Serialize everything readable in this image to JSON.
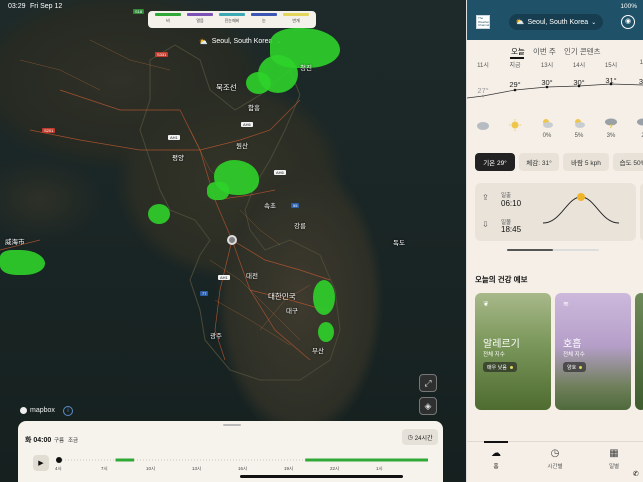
{
  "status": {
    "time": "03:29",
    "date": "Fri Sep 12",
    "battery": "100%"
  },
  "map": {
    "location": "Seoul, South Korea",
    "legend": [
      {
        "label": "비",
        "color": "#2fa836"
      },
      {
        "label": "얼음",
        "color": "#7b52b5"
      },
      {
        "label": "진눈깨비",
        "color": "#3da9b5"
      },
      {
        "label": "눈",
        "color": "#3d55b3"
      },
      {
        "label": "번개",
        "color": "#e3d65a"
      }
    ],
    "labels": {
      "north_korea": "북조선",
      "south_korea": "대한민국",
      "weihai": "威海市",
      "dokdo": "독도",
      "p1": "평양",
      "p2": "원산",
      "p3": "함흥",
      "p4": "청진",
      "p5": "속초",
      "p6": "대전",
      "p7": "광주",
      "p8": "부산",
      "p9": "대구",
      "p10": "강릉"
    },
    "shields": [
      "S18",
      "S331",
      "S201",
      "AH1",
      "AH6",
      "AH6",
      "55",
      "77",
      "AH1"
    ],
    "attribution": "mapbox"
  },
  "timeline": {
    "day_time": "화 04:00",
    "legend_1": "구름",
    "legend_2": "조금",
    "range_button": "24시간",
    "ticks": [
      "4시",
      "7시",
      "10시",
      "13시",
      "16시",
      "19시",
      "22시",
      "1시"
    ],
    "progress": 0.0,
    "precip_segments": [
      [
        0.16,
        0.21
      ],
      [
        0.67,
        1.0
      ]
    ]
  },
  "panel": {
    "location": "Seoul, South Korea",
    "logo": "The Weather Channel",
    "tabs": [
      "오늘",
      "이번 주",
      "인기 콘텐츠"
    ],
    "hourly": [
      {
        "hour": "11시",
        "temp": "27°",
        "icon": "cloud-icon",
        "precip": ""
      },
      {
        "hour": "지금",
        "temp": "29°",
        "icon": "sun-icon",
        "precip": ""
      },
      {
        "hour": "13시",
        "temp": "30°",
        "icon": "partly-sunny-icon",
        "precip": "0%"
      },
      {
        "hour": "14시",
        "temp": "30°",
        "icon": "partly-sunny-icon",
        "precip": "5%"
      },
      {
        "hour": "15시",
        "temp": "31°",
        "icon": "thunderstorm-icon",
        "precip": "3%"
      },
      {
        "hour": "16",
        "temp": "30",
        "icon": "thunderstorm-icon",
        "precip": "2"
      }
    ],
    "chips": [
      "기온 29°",
      "체감: 31°",
      "바람 5 kph",
      "습도 50%"
    ],
    "sun": {
      "sunrise_label": "일출",
      "sunrise": "06:10",
      "sunset_label": "일몰",
      "sunset": "18:45"
    },
    "health_title": "오늘의 건강 예보",
    "health_cards": [
      {
        "title": "알레르기",
        "sub": "전체 지수",
        "badge": "매우 낮음"
      },
      {
        "title": "호흡",
        "sub": "전체 지수",
        "badge": "양호"
      }
    ],
    "nav": [
      {
        "label": "홈",
        "icon": "cloud-rain-icon"
      },
      {
        "label": "시간별",
        "icon": "clock-icon"
      },
      {
        "label": "일별",
        "icon": "calendar-icon"
      }
    ]
  }
}
